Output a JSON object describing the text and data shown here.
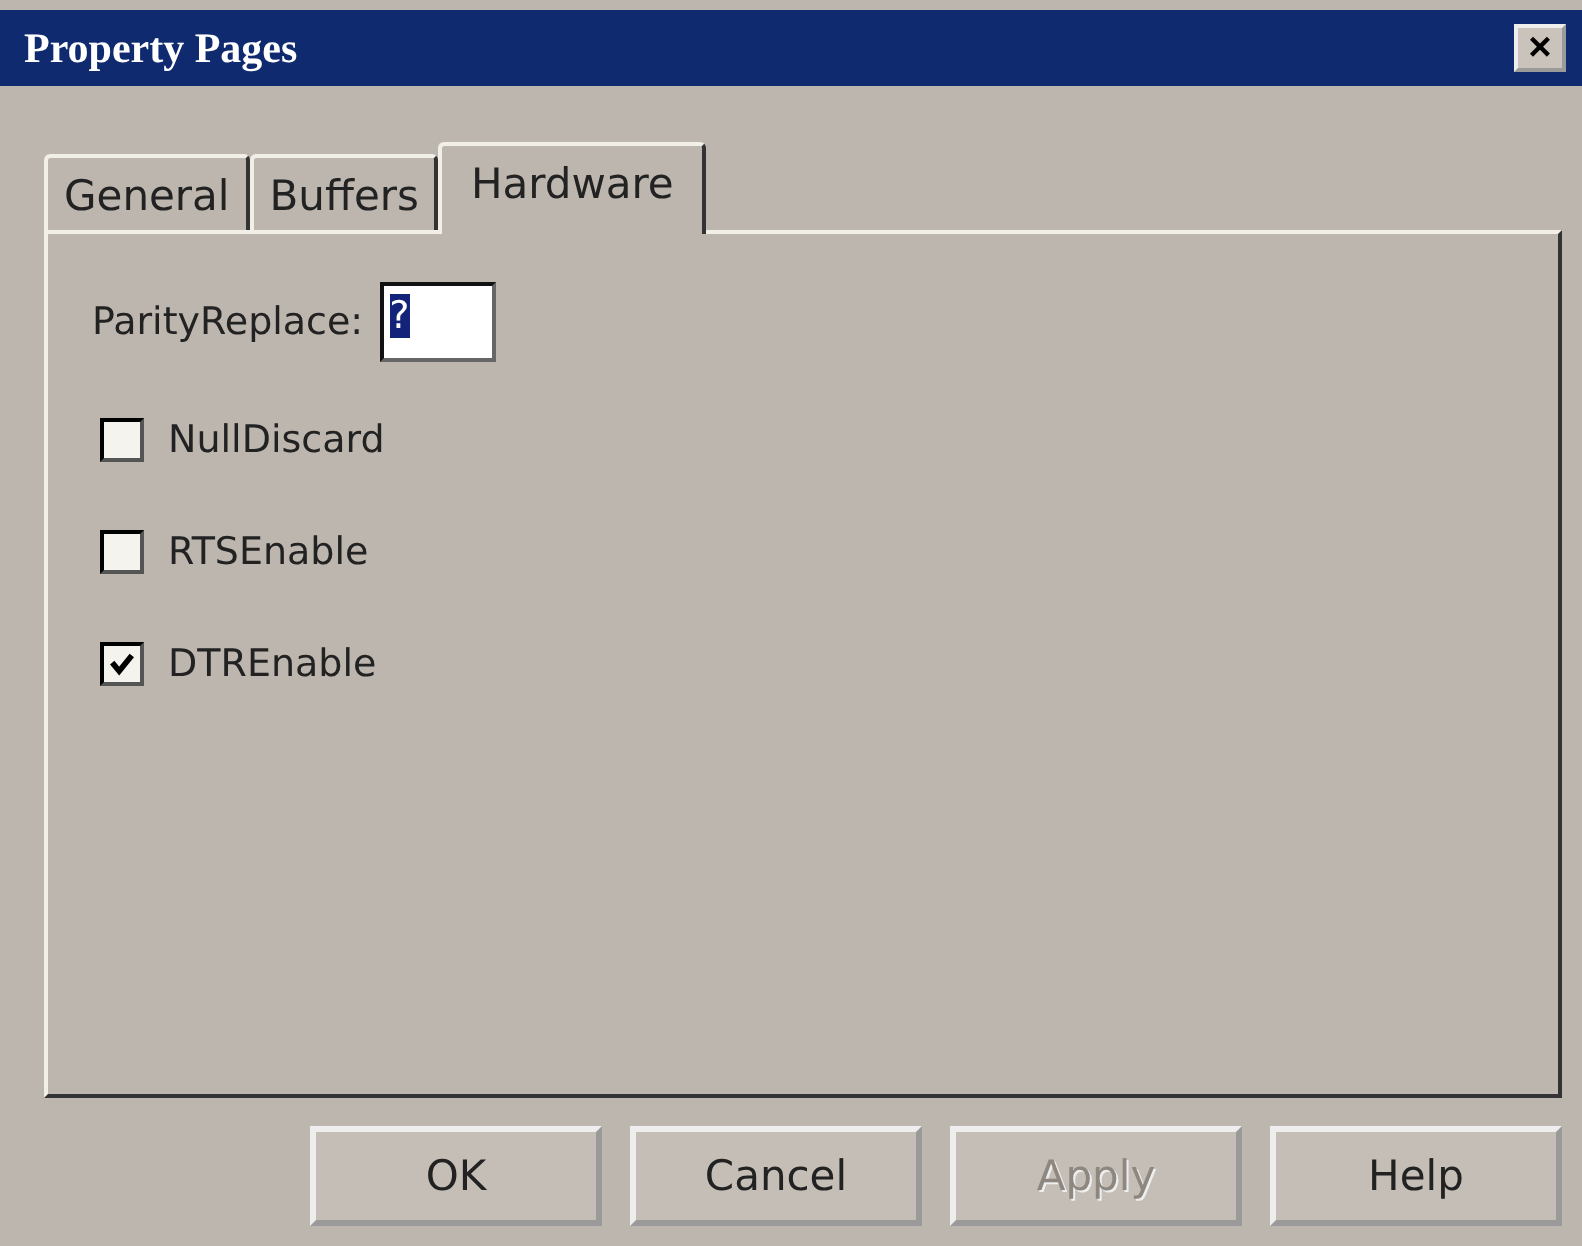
{
  "window": {
    "title": "Property Pages",
    "close": "×"
  },
  "tabs": [
    {
      "label": "General",
      "selected": false
    },
    {
      "label": "Buffers",
      "selected": false
    },
    {
      "label": "Hardware",
      "selected": true
    }
  ],
  "parity_replace": {
    "label": "ParityReplace:",
    "value": "?"
  },
  "checkboxes": [
    {
      "label": "NullDiscard",
      "checked": false
    },
    {
      "label": "RTSEnable",
      "checked": false
    },
    {
      "label": "DTREnable",
      "checked": true
    }
  ],
  "buttons": [
    {
      "label": "OK",
      "disabled": false
    },
    {
      "label": "Cancel",
      "disabled": false
    },
    {
      "label": "Apply",
      "disabled": true
    },
    {
      "label": "Help",
      "disabled": false
    }
  ]
}
